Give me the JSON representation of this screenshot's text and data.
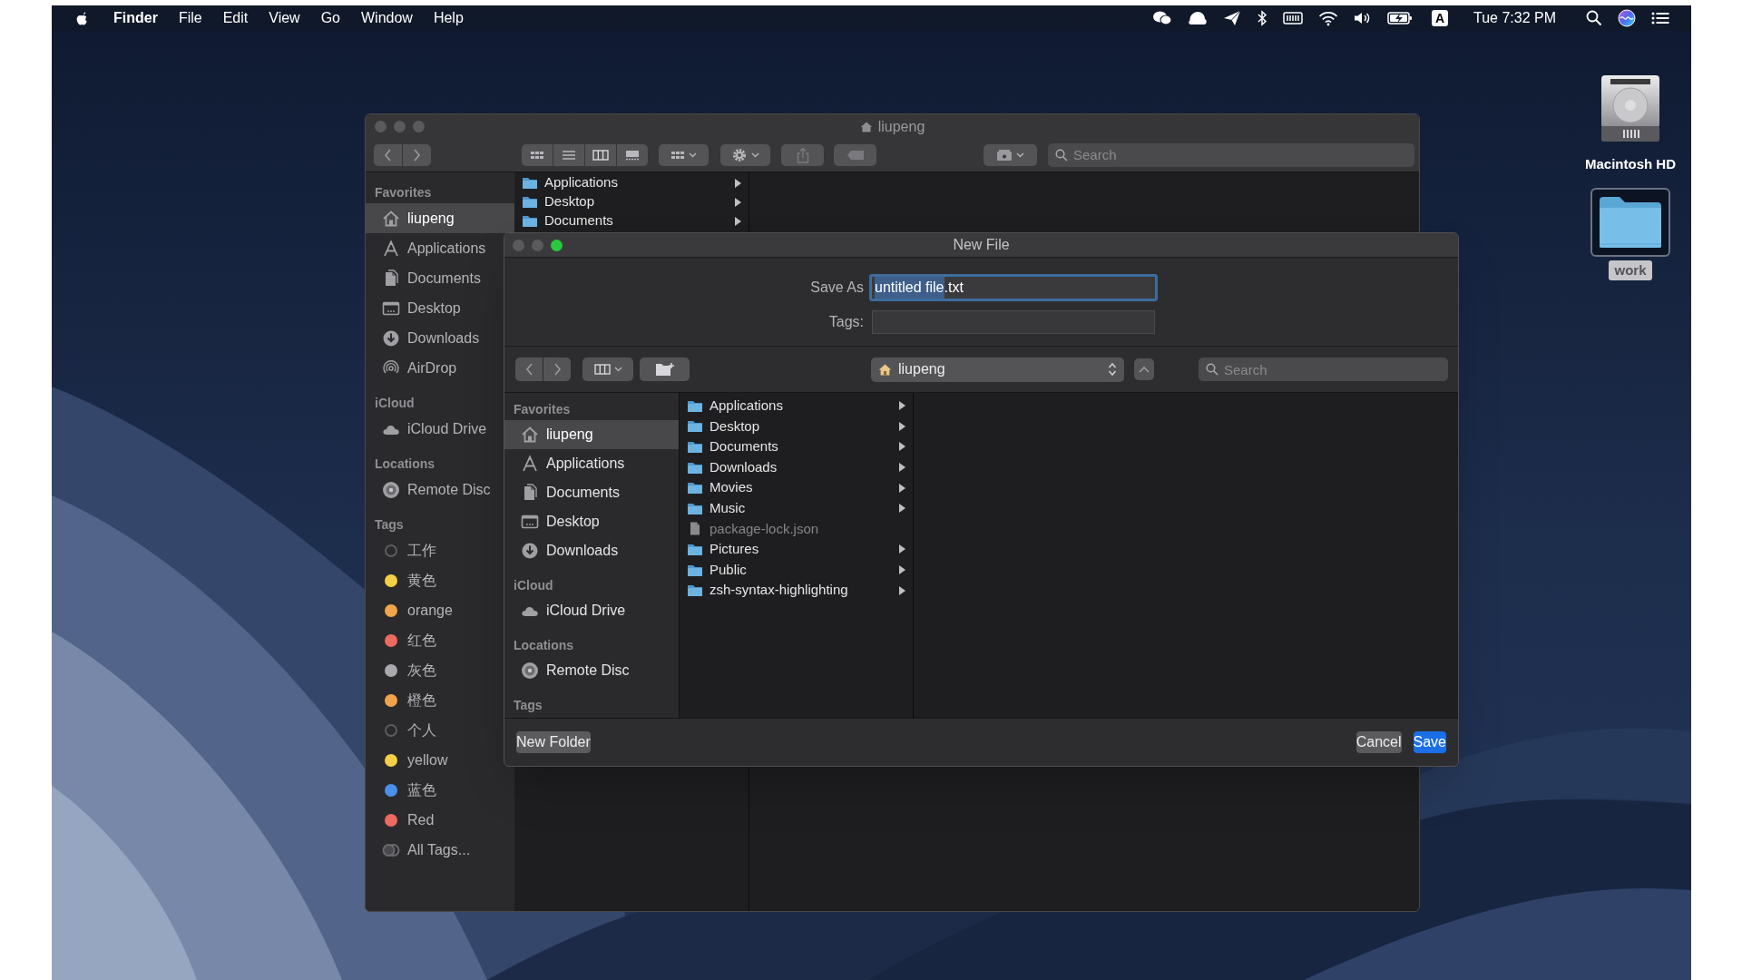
{
  "menu_bar": {
    "app_name": "Finder",
    "menus": [
      "File",
      "Edit",
      "View",
      "Go",
      "Window",
      "Help"
    ],
    "input_source": "A",
    "clock": "Tue 7:32 PM"
  },
  "finder_window": {
    "title": "liupeng",
    "search": {
      "placeholder": "Search"
    },
    "sidebar": [
      {
        "heading": "Favorites",
        "items": [
          {
            "label": "liupeng",
            "kind": "home",
            "selected": true
          },
          {
            "label": "Applications",
            "kind": "applications",
            "selected": false
          },
          {
            "label": "Documents",
            "kind": "documents",
            "selected": false
          },
          {
            "label": "Desktop",
            "kind": "desktop",
            "selected": false
          },
          {
            "label": "Downloads",
            "kind": "downloads",
            "selected": false
          },
          {
            "label": "AirDrop",
            "kind": "airdrop",
            "selected": false
          }
        ]
      },
      {
        "heading": "iCloud",
        "items": [
          {
            "label": "iCloud Drive",
            "kind": "cloud",
            "selected": false
          }
        ]
      },
      {
        "heading": "Locations",
        "items": [
          {
            "label": "Remote Disc",
            "kind": "disc",
            "selected": false
          }
        ]
      },
      {
        "heading": "Tags",
        "items": [
          {
            "label": "工作",
            "kind": "tag-empty",
            "selected": false
          },
          {
            "label": "黄色",
            "kind": "tag",
            "color": "#f5cf46",
            "selected": false
          },
          {
            "label": "orange",
            "kind": "tag",
            "color": "#f1a54a",
            "selected": false
          },
          {
            "label": "红色",
            "kind": "tag",
            "color": "#ee6a5f",
            "selected": false
          },
          {
            "label": "灰色",
            "kind": "tag",
            "color": "#a9a9ae",
            "selected": false
          },
          {
            "label": "橙色",
            "kind": "tag",
            "color": "#f1a54b",
            "selected": false
          },
          {
            "label": "个人",
            "kind": "tag-empty",
            "selected": false
          },
          {
            "label": "yellow",
            "kind": "tag",
            "color": "#f5cf47",
            "selected": false
          },
          {
            "label": "蓝色",
            "kind": "tag",
            "color": "#4a90ea",
            "selected": false
          },
          {
            "label": "Red",
            "kind": "tag",
            "color": "#ee6a60",
            "selected": false
          },
          {
            "label": "All Tags...",
            "kind": "all-tags",
            "selected": false
          }
        ]
      }
    ],
    "column": [
      {
        "name": "Applications"
      },
      {
        "name": "Desktop"
      },
      {
        "name": "Documents"
      }
    ]
  },
  "dialog": {
    "title": "New File",
    "save_as": {
      "label": "Save As",
      "value_parts": [
        {
          "text": "untitled file",
          "selected": true
        },
        {
          "text": ".txt",
          "selected": false
        }
      ]
    },
    "tags": {
      "label": "Tags:"
    },
    "location": "liupeng",
    "search": {
      "placeholder": "Search"
    },
    "sidebar": [
      {
        "heading": "Favorites",
        "items": [
          {
            "label": "liupeng",
            "kind": "home",
            "selected": true
          },
          {
            "label": "Applications",
            "kind": "applications",
            "selected": false
          },
          {
            "label": "Documents",
            "kind": "documents",
            "selected": false
          },
          {
            "label": "Desktop",
            "kind": "desktop",
            "selected": false
          },
          {
            "label": "Downloads",
            "kind": "downloads",
            "selected": false
          }
        ]
      },
      {
        "heading": "iCloud",
        "items": [
          {
            "label": "iCloud Drive",
            "kind": "cloud",
            "selected": false
          }
        ]
      },
      {
        "heading": "Locations",
        "items": [
          {
            "label": "Remote Disc",
            "kind": "disc",
            "selected": false
          }
        ]
      },
      {
        "heading": "Tags"
      }
    ],
    "files": [
      {
        "name": "Applications",
        "kind": "folder",
        "disabled": false
      },
      {
        "name": "Desktop",
        "kind": "folder",
        "disabled": false
      },
      {
        "name": "Documents",
        "kind": "folder",
        "disabled": false
      },
      {
        "name": "Downloads",
        "kind": "folder",
        "disabled": false
      },
      {
        "name": "Movies",
        "kind": "folder",
        "disabled": false
      },
      {
        "name": "Music",
        "kind": "folder",
        "disabled": false
      },
      {
        "name": "package-lock.json",
        "kind": "file",
        "disabled": true
      },
      {
        "name": "Pictures",
        "kind": "folder",
        "disabled": false
      },
      {
        "name": "Public",
        "kind": "folder",
        "disabled": false
      },
      {
        "name": "zsh-syntax-highlighting",
        "kind": "folder",
        "disabled": false
      }
    ],
    "buttons": [
      {
        "label": "New Folder",
        "kind": "normal"
      },
      {
        "label": "Cancel",
        "kind": "normal"
      },
      {
        "label": "Save",
        "kind": "default"
      }
    ]
  },
  "desktop_icons": [
    {
      "label": "Macintosh HD",
      "kind": "drive",
      "selected": false
    },
    {
      "label": "work",
      "kind": "folder",
      "selected": true
    }
  ]
}
